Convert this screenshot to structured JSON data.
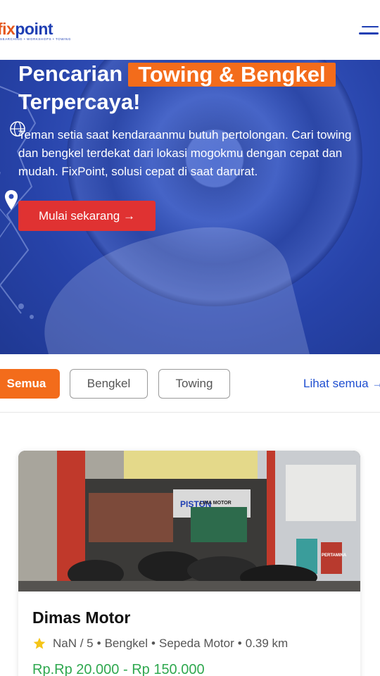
{
  "header": {
    "logo_fix": "fix",
    "logo_point": "point",
    "logo_tagline": "SEARCHING • WORKSHOPS • TOWING"
  },
  "hero": {
    "title_prefix": "Pencarian",
    "title_highlight": "Towing & Bengkel",
    "title_suffix": "Terpercaya!",
    "subtitle": "Teman setia saat kendaraanmu butuh pertolongan. Cari towing dan bengkel terdekat dari lokasi mogokmu dengan cepat dan mudah. FixPoint, solusi cepat di saat darurat.",
    "cta_label": "Mulai sekarang →"
  },
  "filters": {
    "chips": [
      "Semua",
      "Bengkel",
      "Towing"
    ],
    "active": "Semua",
    "see_all": "Lihat semua →"
  },
  "listing": {
    "name": "Dimas Motor",
    "rating": "NaN / 5",
    "category": "Bengkel",
    "vehicle": "Sepeda Motor",
    "distance": "0.39 km",
    "price": "Rp.Rp 20.000 - Rp 150.000",
    "shop_sign": "PISTON",
    "shop_sign_2": "LIMA MOTOR",
    "shop_sign_3": "PERTAMINA"
  },
  "colors": {
    "brand_blue": "#1f3fb3",
    "brand_orange": "#f36c1b",
    "cta_red": "#e03232",
    "price_green": "#2fa84f",
    "link_blue": "#1f4fd1"
  },
  "icons": [
    "menu-icon",
    "map-pin-icon",
    "globe-icon",
    "star-icon"
  ]
}
